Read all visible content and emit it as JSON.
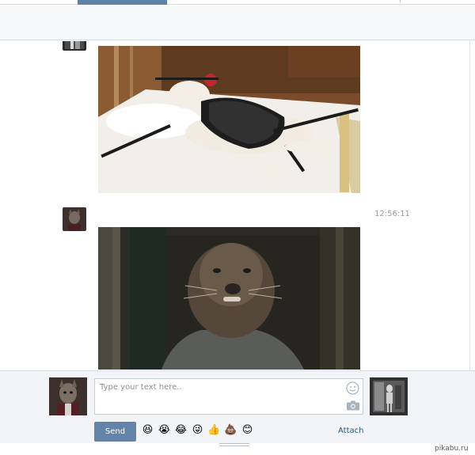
{
  "messages": [
    {
      "sender": "peer",
      "photo_subject": "white rat in black lace corset on white pillow",
      "time": ""
    },
    {
      "sender": "me",
      "photo_subject": "furry rat-man creature in grey shirt in dark room",
      "time": "12:56:11"
    }
  ],
  "composer": {
    "placeholder": "Type your text here..",
    "value": "",
    "send_label": "Send",
    "attach_label": "Attach",
    "emojis": [
      "😆",
      "😭",
      "😂",
      "😜",
      "👍",
      "💩",
      "😊"
    ],
    "smile_icon": "smile-icon",
    "camera_icon": "camera-icon"
  },
  "watermark": "pikabu.ru",
  "colors": {
    "accent": "#5e81a8",
    "send_button": "#6383a8",
    "link": "#2b587a",
    "composer_bg": "#f2f4f7"
  }
}
